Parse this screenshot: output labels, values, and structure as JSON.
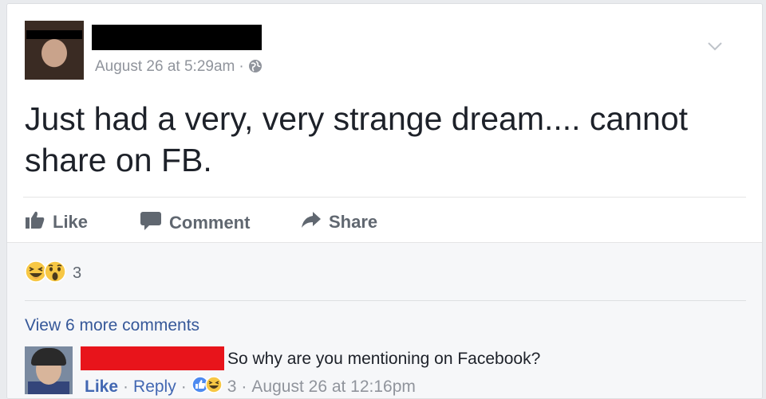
{
  "post": {
    "timestamp": "August 26 at 5:29am",
    "separator": "·",
    "privacy_icon": "globe-icon",
    "text": "Just had a very, very strange dream.... cannot share on FB."
  },
  "actions": {
    "like": "Like",
    "comment": "Comment",
    "share": "Share"
  },
  "reactions": {
    "icons": [
      "haha-emoji-icon",
      "wow-emoji-icon"
    ],
    "count": "3"
  },
  "comments": {
    "view_more": "View 6 more comments",
    "items": [
      {
        "text": "So why are you mentioning on Facebook?",
        "like": "Like",
        "reply": "Reply",
        "reaction_count": "3",
        "timestamp": "August 26 at 12:16pm"
      }
    ]
  },
  "colors": {
    "link": "#365899",
    "like_link": "#4267b2",
    "redaction_black": "#000000",
    "redaction_red": "#e8141b",
    "muted": "#90949c",
    "action_gray": "#606770"
  }
}
